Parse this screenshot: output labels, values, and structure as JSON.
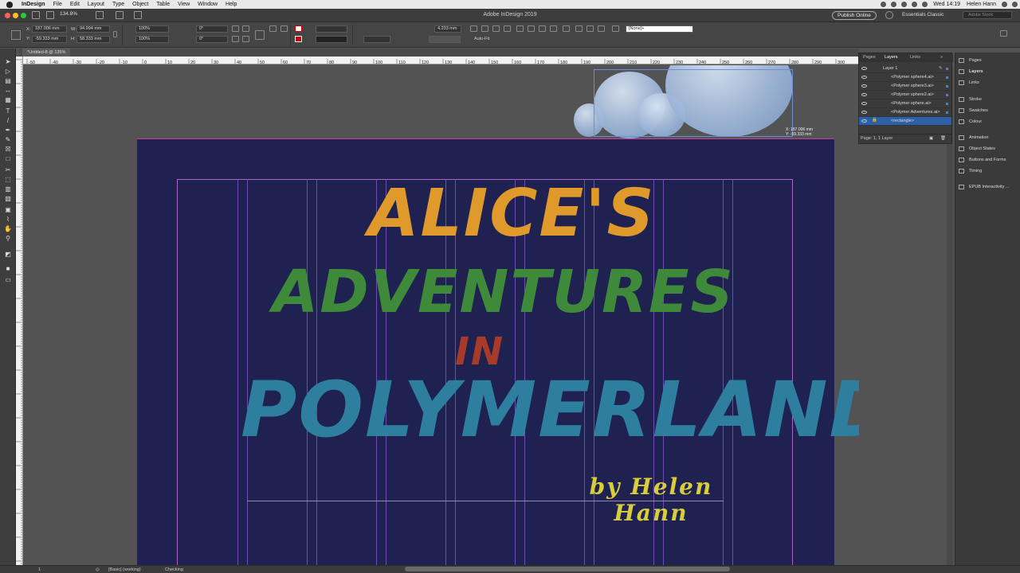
{
  "menubar": {
    "app": "InDesign",
    "menus": [
      "File",
      "Edit",
      "Layout",
      "Type",
      "Object",
      "Table",
      "View",
      "Window",
      "Help"
    ],
    "clock": "Wed 14:19",
    "user": "Helen Hann"
  },
  "appbar": {
    "window_title": "Adobe InDesign 2019",
    "zoom": "134.8%",
    "publish_label": "Publish Online",
    "workspace": "Essentials Classic",
    "stock_placeholder": "Adobe Stock"
  },
  "control": {
    "x": "187.006 mm",
    "y": "-59.333 mm",
    "w": "94.994 mm",
    "h": "58.333 mm",
    "scale_x": "100%",
    "scale_y": "100%",
    "rotate": "0°",
    "shear": "0°",
    "stroke_weight": "4.233 mm",
    "style": "[None]+",
    "autofit": "Auto-Fit"
  },
  "doc_tab": "*Untitled-8 @ 135%",
  "ruler_labels": [
    "-50",
    "-40",
    "-30",
    "-20",
    "-10",
    "0",
    "10",
    "20",
    "30",
    "40",
    "50",
    "60",
    "70",
    "80",
    "90",
    "100",
    "110",
    "120",
    "130",
    "140",
    "150",
    "160",
    "170",
    "180",
    "190",
    "200",
    "210",
    "220",
    "230",
    "240",
    "250",
    "260",
    "270",
    "280",
    "290",
    "300"
  ],
  "cover": {
    "line1": "ALICE'S",
    "line2": "ADVENTURES",
    "line3": "IN",
    "line4": "POLYMERLAND",
    "byline": "by Helen Hann"
  },
  "cursor_readout": {
    "x": "X: 187.006 mm",
    "y": "Y: -59.333 mm"
  },
  "layers_panel": {
    "tabs": [
      "Pages",
      "Layers",
      "Links"
    ],
    "active_tab": "Layers",
    "layer_name": "Layer 1",
    "items": [
      "<Polymer sphere4.ai>",
      "<Polymer sphere3.ai>",
      "<Polymer sphere2.ai>",
      "<Polymer sphere.ai>",
      "<Polymer Adventures.ai>",
      "<rectangle>"
    ],
    "footer": "Page: 1, 1 Layer"
  },
  "right_panels": {
    "group1": [
      "Pages",
      "Layers",
      "Links"
    ],
    "group2": [
      "Stroke",
      "Swatches",
      "Colour"
    ],
    "group3": [
      "Animation",
      "Object States",
      "Buttons and Forms",
      "Timing"
    ],
    "group4": [
      "EPUB Interactivity ..."
    ]
  },
  "status": {
    "page": "1",
    "profile": "[Basic] (working)",
    "preflight": "Checking"
  },
  "colors": {
    "page_bg": "#1f2150",
    "title_orange": "#e09a2b",
    "title_green": "#3f8a3a",
    "title_red": "#a83a2a",
    "title_blue": "#2e7ea0",
    "byline_yellow": "#d8cd3a"
  }
}
